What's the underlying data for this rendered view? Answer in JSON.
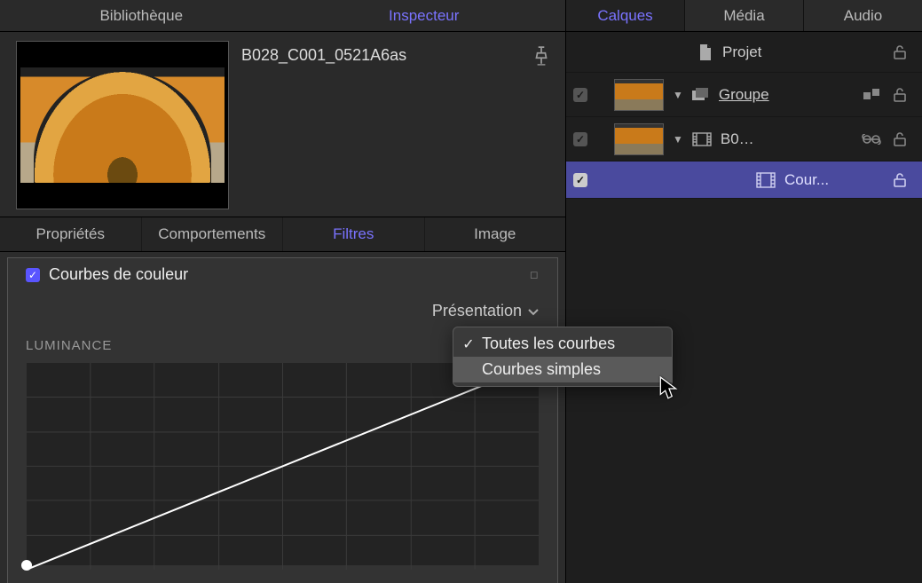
{
  "left": {
    "topTabs": {
      "library": "Bibliothèque",
      "inspector": "Inspecteur"
    },
    "clipTitle": "B028_C001_0521A6as",
    "subTabs": {
      "properties": "Propriétés",
      "behaviors": "Comportements",
      "filters": "Filtres",
      "image": "Image"
    },
    "section": {
      "title": "Courbes de couleur"
    },
    "viewDropdown": {
      "label": "Présentation"
    },
    "luminanceLabel": "LUMINANCE",
    "menu": {
      "opt1": "Toutes les courbes",
      "opt2": "Courbes simples"
    }
  },
  "right": {
    "tabs": {
      "layers": "Calques",
      "media": "Média",
      "audio": "Audio"
    },
    "project": {
      "name": "Projet"
    },
    "group": {
      "name": "Groupe"
    },
    "clip": {
      "name": "B0…"
    },
    "filterLayer": {
      "name": "Cour..."
    }
  },
  "chart_data": {
    "type": "line",
    "title": "LUMINANCE",
    "x": [
      0,
      1
    ],
    "values": [
      0,
      1
    ],
    "xlim": [
      0,
      1
    ],
    "ylim": [
      0,
      1
    ],
    "xlabel": "",
    "ylabel": ""
  }
}
